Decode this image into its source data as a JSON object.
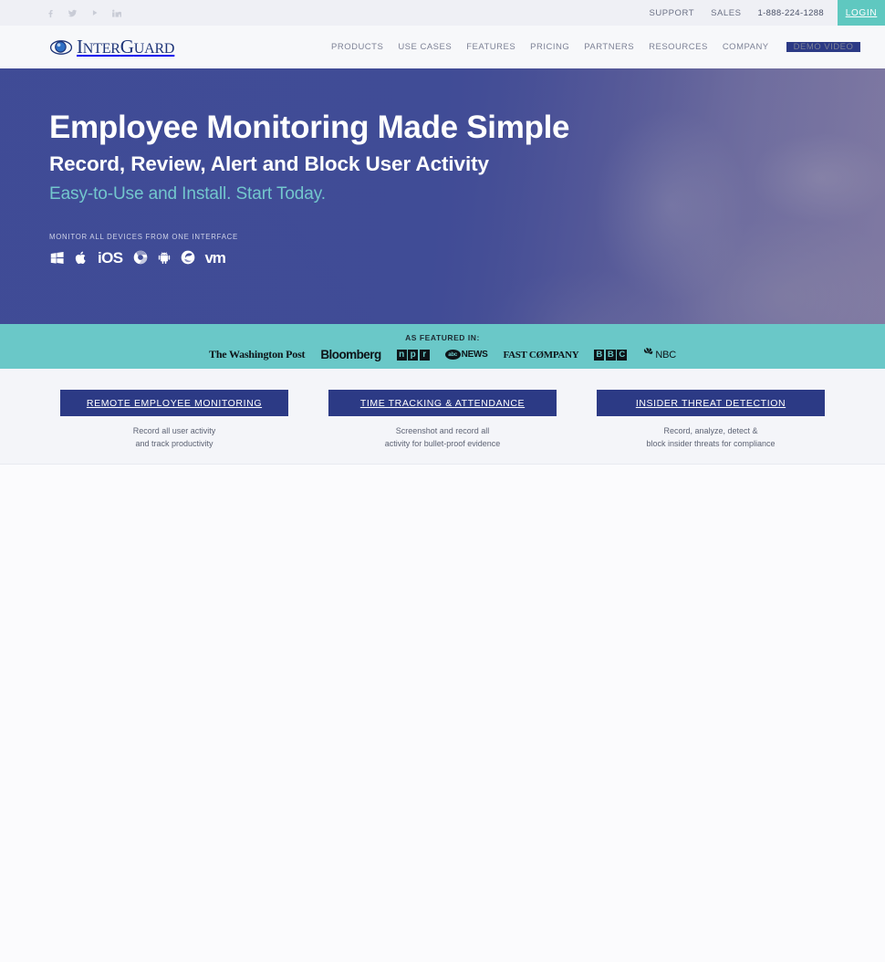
{
  "topbar": {
    "social": [
      {
        "name": "facebook-icon",
        "label": "f"
      },
      {
        "name": "twitter-icon",
        "label": "t"
      },
      {
        "name": "youtube-icon",
        "label": "play"
      },
      {
        "name": "linkedin-icon",
        "label": "in"
      }
    ],
    "support": "SUPPORT",
    "sales": "SALES",
    "phone": "1-888-224-1288",
    "login": "LOGIN",
    "login_bg": "#5fc8c0"
  },
  "header": {
    "logo_text_inter": "I",
    "logo_text_nter": "NTER",
    "logo_text_g": "G",
    "logo_text_uard": "UARD",
    "logo_full": "INTERGUARD",
    "nav": [
      {
        "label": "PRODUCTS"
      },
      {
        "label": "USE CASES"
      },
      {
        "label": "FEATURES"
      },
      {
        "label": "PRICING"
      },
      {
        "label": "PARTNERS"
      },
      {
        "label": "RESOURCES"
      },
      {
        "label": "COMPANY"
      }
    ],
    "demo_button": "DEMO VIDEO",
    "demo_bg": "#2c3a85"
  },
  "hero": {
    "headline": "Employee Monitoring Made Simple",
    "subheadline": "Record, Review, Alert and Block User Activity",
    "tagline": "Easy-to-Use and Install. Start Today.",
    "tagline_color": "#73c7cd",
    "devices_label": "MONITOR ALL DEVICES FROM ONE INTERFACE",
    "devices": [
      {
        "name": "windows-icon",
        "label": "Windows"
      },
      {
        "name": "apple-icon",
        "label": "Apple"
      },
      {
        "name": "ios-icon",
        "label": "iOS"
      },
      {
        "name": "chrome-icon",
        "label": "Chrome"
      },
      {
        "name": "android-icon",
        "label": "Android"
      },
      {
        "name": "browser-icon",
        "label": "Browser"
      },
      {
        "name": "vmware-icon",
        "label": "vm"
      }
    ],
    "bg_color": "#3f4b96"
  },
  "featured": {
    "label": "AS FEATURED IN:",
    "bg_color": "#6ac8c8",
    "logos": [
      {
        "name": "washington-post-logo",
        "text": "The Washington Post"
      },
      {
        "name": "bloomberg-logo",
        "text": "Bloomberg"
      },
      {
        "name": "npr-logo",
        "letters": [
          "n",
          "p",
          "r"
        ]
      },
      {
        "name": "abc-news-logo",
        "oval": "abc",
        "text": "NEWS"
      },
      {
        "name": "fast-company-logo",
        "text": "FAST CØMPANY"
      },
      {
        "name": "bbc-logo",
        "letters": [
          "B",
          "B",
          "C"
        ]
      },
      {
        "name": "nbc-logo",
        "text": "NBC"
      }
    ]
  },
  "cards": [
    {
      "title": "REMOTE EMPLOYEE MONITORING",
      "line1": "Record all user activity",
      "line2": "and track productivity"
    },
    {
      "title": "TIME TRACKING & ATTENDANCE",
      "line1": "Screenshot and record all",
      "line2": "activity for bullet-proof evidence"
    },
    {
      "title": "INSIDER THREAT DETECTION",
      "line1": "Record, analyze, detect &",
      "line2": "block insider threats for compliance"
    }
  ]
}
